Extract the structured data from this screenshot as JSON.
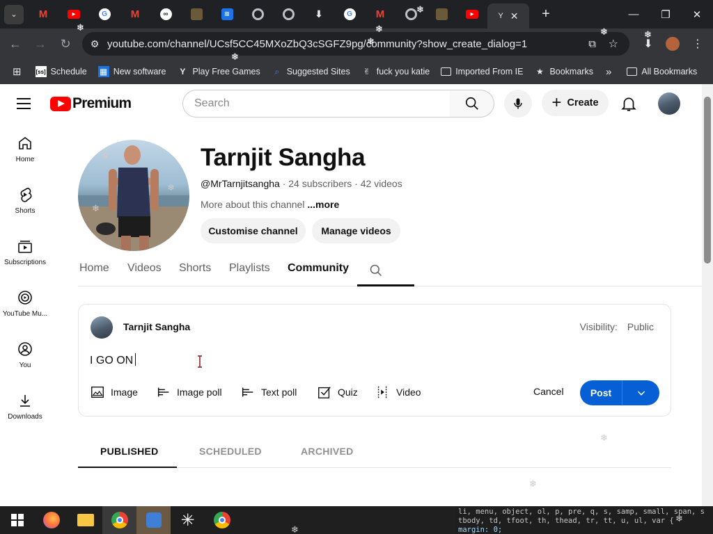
{
  "browser": {
    "active_tab_title": "Y",
    "address": "youtube.com/channel/UCsf5CC45MXoZbQ3cSGFZ9pg/community?show_create_dialog=1",
    "bookmarks": [
      {
        "label": "Schedule",
        "icon": "schedule-icon"
      },
      {
        "label": "New software",
        "icon": "software-icon"
      },
      {
        "label": "Play Free Games",
        "icon": "games-icon"
      },
      {
        "label": "Suggested Sites",
        "icon": "suggested-icon"
      },
      {
        "label": "fuck you katie",
        "icon": "bookmark-icon"
      },
      {
        "label": "Imported From IE",
        "icon": "folder-icon"
      },
      {
        "label": "Bookmarks",
        "icon": "star-icon"
      }
    ],
    "overflow_label": "»",
    "all_bookmarks": "All Bookmarks"
  },
  "youtube": {
    "logo_text": "Premium",
    "search_placeholder": "Search",
    "create_label": "Create",
    "sidebar": [
      {
        "label": "Home",
        "icon": "home-icon"
      },
      {
        "label": "Shorts",
        "icon": "shorts-icon"
      },
      {
        "label": "Subscriptions",
        "icon": "subscriptions-icon"
      },
      {
        "label": "YouTube Mu...",
        "icon": "youtube-music-icon"
      },
      {
        "label": "You",
        "icon": "you-icon"
      },
      {
        "label": "Downloads",
        "icon": "downloads-icon"
      }
    ],
    "channel": {
      "name": "Tarnjit Sangha",
      "handle": "@MrTarnjitsangha",
      "subscribers": "24 subscribers",
      "videos": "42 videos",
      "about": "More about this channel",
      "more": "...more",
      "customise_label": "Customise channel",
      "manage_label": "Manage videos"
    },
    "tabs": [
      "Home",
      "Videos",
      "Shorts",
      "Playlists",
      "Community"
    ],
    "active_tab": "Community",
    "composer": {
      "author": "Tarnjit Sangha",
      "visibility_label": "Visibility:",
      "visibility_value": "Public",
      "text": "I GO ON",
      "tools": [
        "Image",
        "Image poll",
        "Text poll",
        "Quiz",
        "Video"
      ],
      "cancel_label": "Cancel",
      "post_label": "Post"
    },
    "post_tabs": [
      "PUBLISHED",
      "SCHEDULED",
      "ARCHIVED"
    ],
    "active_post_tab": "PUBLISHED"
  },
  "code_panel": {
    "line1": "li, menu, object, ol, p, pre, q, s, samp, small, span, s",
    "line2": "tbody, td, tfoot, th, thead, tr, tt, u, ul, var {",
    "line3": "    margin: 0;"
  }
}
